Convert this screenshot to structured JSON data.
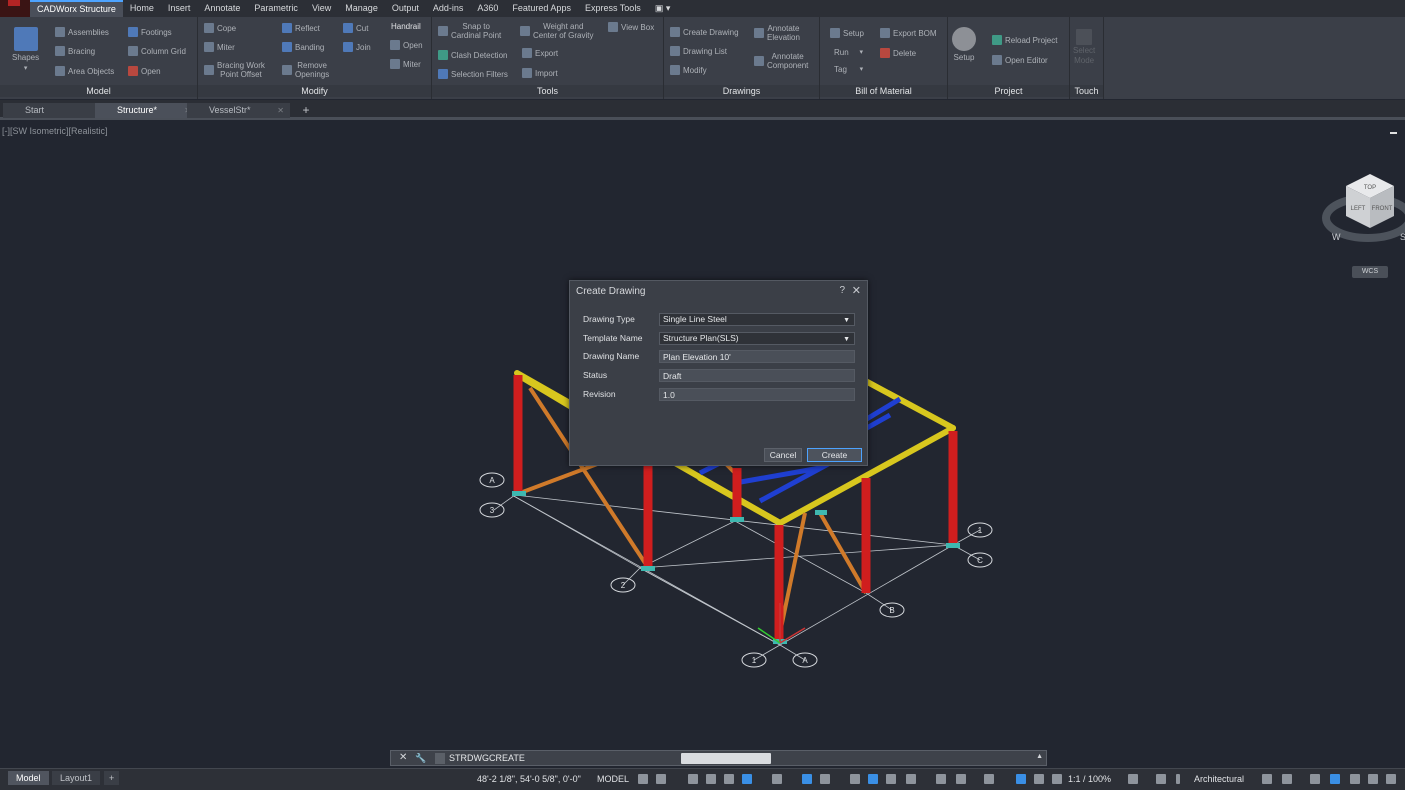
{
  "ribbon_tabs": [
    "CADWorx Structure",
    "Home",
    "Insert",
    "Annotate",
    "Parametric",
    "View",
    "Manage",
    "Output",
    "Add-ins",
    "A360",
    "Featured Apps",
    "Express Tools"
  ],
  "active_tab": "CADWorx Structure",
  "panels": {
    "model": {
      "title": "Model",
      "shapes": "Shapes",
      "assemblies": "Assemblies",
      "footings": "Footings",
      "bracing": "Bracing",
      "column_grid": "Column Grid",
      "area_objects": "Area Objects",
      "open": "Open"
    },
    "modify": {
      "title": "Modify",
      "cope": "Cope",
      "reflect": "Reflect",
      "cut": "Cut",
      "miter": "Miter",
      "banding": "Banding",
      "join": "Join",
      "bracing_work": "Bracing Work",
      "point_offset": "Point Offset",
      "remove": "Remove",
      "openings": "Openings",
      "handrail": "Handrail",
      "hr_open": "Open",
      "hr_miter": "Miter"
    },
    "tools": {
      "title": "Tools",
      "snap_to": "Snap to",
      "cardinal_point": "Cardinal Point",
      "weight_and": "Weight and",
      "center_of_gravity": "Center of Gravity",
      "view_box": "View Box",
      "clash_detection": "Clash Detection",
      "export": "Export",
      "selection_filters": "Selection Filters",
      "import": "Import"
    },
    "drawings": {
      "title": "Drawings",
      "create_drawing": "Create Drawing",
      "annotate": "Annotate",
      "elevation": "Elevation",
      "drawing_list": "Drawing List",
      "annotate2": "Annotate",
      "component": "Component",
      "modify": "Modify"
    },
    "bom": {
      "title": "Bill of Material",
      "setup": "Setup",
      "export_bom": "Export BOM",
      "run": "Run",
      "delete": "Delete",
      "tag": "Tag"
    },
    "project": {
      "title": "Project",
      "setup": "Setup",
      "reload_project": "Reload Project",
      "open_editor": "Open Editor"
    },
    "touch": {
      "title": "Touch",
      "select": "Select",
      "mode": "Mode"
    }
  },
  "doc_tabs": [
    {
      "label": "Start"
    },
    {
      "label": "Structure*"
    },
    {
      "label": "VesselStr*"
    }
  ],
  "viewport_label": "[-][SW Isometric][Realistic]",
  "viewcube": {
    "top": "TOP",
    "left": "LEFT",
    "front": "FRONT",
    "compass_w": "W",
    "compass_s": "S",
    "wcs": "WCS"
  },
  "grid_bubbles": [
    "A",
    "3",
    "2",
    "1",
    "A",
    "B",
    "1",
    "C"
  ],
  "dialog": {
    "title": "Create Drawing",
    "help": "?",
    "close": "✕",
    "fields": [
      {
        "label": "Drawing Type",
        "value": "Single Line Steel",
        "type": "select"
      },
      {
        "label": "Template Name",
        "value": "Structure Plan(SLS)",
        "type": "select"
      },
      {
        "label": "Drawing Name",
        "value": "Plan Elevation 10'",
        "type": "text"
      },
      {
        "label": "Status",
        "value": "Draft",
        "type": "text"
      },
      {
        "label": "Revision",
        "value": "1.0",
        "type": "text"
      }
    ],
    "cancel": "Cancel",
    "create": "Create"
  },
  "command": {
    "text": "STRDWGCREATE",
    "close": "✕",
    "wrench": "🔧"
  },
  "layout_tabs": [
    "Model",
    "Layout1"
  ],
  "status": {
    "coords": "48'-2 1/8\", 54'-0 5/8\", 0'-0\"",
    "mode": "MODEL",
    "scale": "1:1 / 100%",
    "units": "Architectural"
  }
}
